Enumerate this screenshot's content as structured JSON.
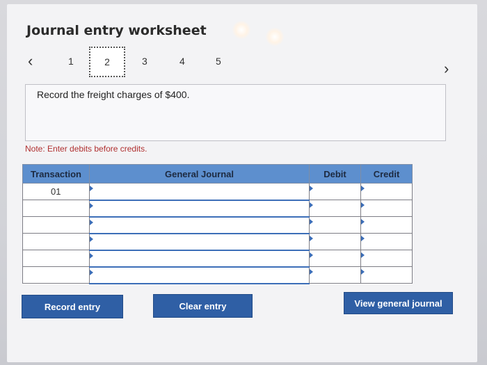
{
  "header": {
    "title": "Journal entry worksheet"
  },
  "nav": {
    "steps": [
      "1",
      "2",
      "3",
      "4",
      "5"
    ],
    "active_step": "2"
  },
  "prompt": {
    "text": "Record the freight charges of $400."
  },
  "note": {
    "text": "Note: Enter debits before credits."
  },
  "table": {
    "columns": [
      "Transaction",
      "General Journal",
      "Debit",
      "Credit"
    ],
    "rows": [
      {
        "transaction": "01",
        "account": "",
        "debit": "",
        "credit": ""
      },
      {
        "transaction": "",
        "account": "",
        "debit": "",
        "credit": ""
      },
      {
        "transaction": "",
        "account": "",
        "debit": "",
        "credit": ""
      },
      {
        "transaction": "",
        "account": "",
        "debit": "",
        "credit": ""
      },
      {
        "transaction": "",
        "account": "",
        "debit": "",
        "credit": ""
      },
      {
        "transaction": "",
        "account": "",
        "debit": "",
        "credit": ""
      }
    ]
  },
  "buttons": {
    "record": "Record entry",
    "clear": "Clear entry",
    "view_journal": "View general journal"
  },
  "colors": {
    "header_blue": "#5d8fce",
    "button_blue": "#2f5fa5",
    "note_red": "#b03030"
  },
  "icons": {
    "prev": "chevron-left-icon",
    "next": "chevron-right-icon"
  }
}
